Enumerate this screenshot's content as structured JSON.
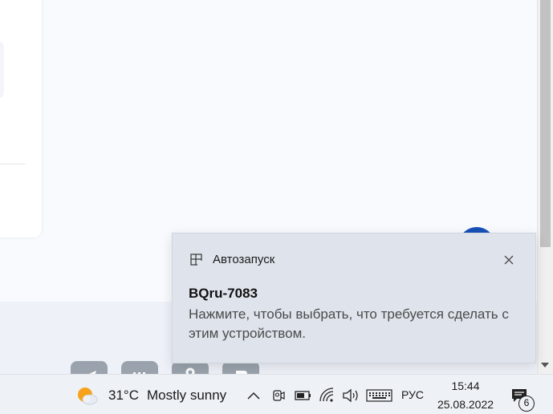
{
  "toast": {
    "app_name": "Автозапуск",
    "title": "BQru-7083",
    "body": "Нажмите, чтобы выбрать, что требуется сделать с этим устройством."
  },
  "taskbar": {
    "weather": {
      "temperature": "31°C",
      "condition": "Mostly sunny",
      "icon": "partly-sunny-icon"
    },
    "language": "РУС",
    "time": "15:44",
    "date": "25.08.2022",
    "notification_count": "6"
  },
  "dock": {
    "icons": [
      "telegram-icon",
      "vk-icon",
      "odnoklassniki-icon",
      "vk-logo-icon"
    ]
  },
  "colors": {
    "toast_bg": "#dfe4ec",
    "taskbar_bg": "#eef1f6",
    "avatar": "#1850b8"
  }
}
